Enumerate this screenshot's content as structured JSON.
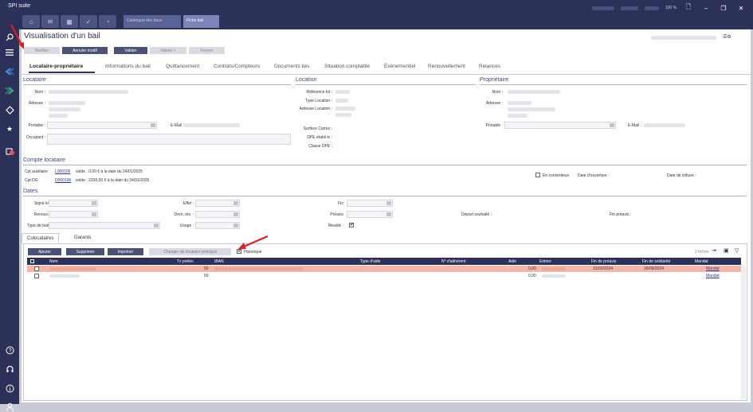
{
  "app": {
    "title": "SPI suite",
    "zoom": "100 %"
  },
  "window_controls": {
    "file": "🗋",
    "minimize": "–",
    "restore": "❐",
    "close": "✕"
  },
  "doc_tabs": [
    "Catalogue des baux",
    "Fiche bail"
  ],
  "page": {
    "title": "Visualisation d'un bail"
  },
  "toolbar": {
    "modifier": "Modifier",
    "annuler": "Annuler modif",
    "valider": "Valider",
    "valider_plus": "Valider +",
    "fermer": "Fermer"
  },
  "tabs": [
    "Locataire-propriétaire",
    "Informations du bail",
    "Quittancement",
    "Contrats/Compteurs",
    "Documents liés",
    "Situation comptable",
    "Événementiel",
    "Renouvellement",
    "Relances"
  ],
  "locataire": {
    "title": "Locataire",
    "nom": "Nom :",
    "adresse": "Adresse :",
    "portable": "Portable :",
    "email": "E-Mail :",
    "occupant": "Occupant :"
  },
  "location": {
    "title": "Location",
    "ref_lot": "Référence lot :",
    "type": "Type Location :",
    "adresse": "Adresse Location :",
    "surface": "Surface Carrez :",
    "dpe_etabli": "DPE établi le :",
    "classe_dpe": "Classe DPE :"
  },
  "proprietaire": {
    "title": "Propriétaire",
    "nom": "Nom :",
    "adresse": "Adresse :",
    "portable": "Portable :",
    "email": "E-Mail :"
  },
  "compte": {
    "title": "Compte locataire",
    "cpt_aux_label": "Cpt auxiliaire",
    "cpt_aux_link": "L000196",
    "cpt_aux_solde": "solde : 0,00 € à la date du 24/01/2025",
    "cpt_dg_label": "Cpt DG",
    "cpt_dg_link": "D000196",
    "cpt_dg_solde": "solde : 2200,00 € à la date du 24/01/2025",
    "contentieux": "En contentieux",
    "date_ouverture": "Date d'ouverture :",
    "date_cloture": "Date de clôture :"
  },
  "dates": {
    "title": "Dates",
    "signe": "Signé le",
    "renouv": "Renouv.",
    "type_bail": "Type de bail",
    "effet": "Effet :",
    "dern_rev": "Dern. rév. :",
    "usage": "Usage :",
    "fin": "Fin",
    "preavis": "Préavis",
    "meuble": "Meublé :",
    "depart": "Départ souhaité :",
    "fin_preavis": "Fin préavis :"
  },
  "coloc_tabs": [
    "Colocataires",
    "Garants"
  ],
  "grid_buttons": {
    "ajouter": "Ajouter",
    "supprimer": "Supprimer",
    "imprimer": "Imprimer",
    "changer": "Changer de locataire principal",
    "historique": "Historique"
  },
  "grid_info": "2 fiches",
  "grid_columns": [
    "Nom",
    "Tx prélèv.",
    "IBAN",
    "Type d'aide",
    "N° d'adhérent",
    "Aide",
    "Entrée",
    "Fin de préavis",
    "Fin de solidarité",
    "Mandat"
  ],
  "grid_rows": [
    {
      "tx": "50",
      "aide": "0,00",
      "fin_preavis": "31/03/2024",
      "fin_solidarite": "30/09/2024",
      "mandat": "Mandat",
      "highlight": true
    },
    {
      "tx": "50",
      "aide": "0,00",
      "fin_preavis": "",
      "fin_solidarite": "",
      "mandat": "Mandat",
      "highlight": false
    }
  ],
  "colors": {
    "navy": "#2b3158",
    "highlight_row": "#f7b5a8",
    "annotation_arrow": "#e21e1e"
  },
  "icons": [
    "search-icon",
    "menu-icon",
    "arrow-left-icon",
    "arrow-right-icon",
    "diamond-icon",
    "star-icon",
    "notification-icon",
    "help-icon",
    "headset-icon",
    "info-icon",
    "user-icon",
    "home-icon",
    "mail-icon",
    "calendar-icon",
    "check-icon",
    "bell-icon"
  ]
}
